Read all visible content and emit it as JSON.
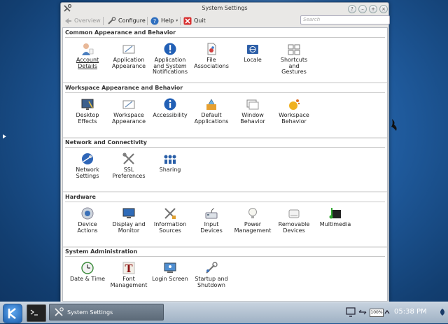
{
  "window": {
    "title": "System Settings",
    "search_placeholder": "Search"
  },
  "toolbar": {
    "overview": "Overview",
    "configure": "Configure",
    "help": "Help",
    "quit": "Quit"
  },
  "sections": [
    {
      "title": "Common Appearance and Behavior",
      "items": [
        {
          "label": "Account\nDetails",
          "icon": "account-icon"
        },
        {
          "label": "Application\nAppearance",
          "icon": "appearance-icon"
        },
        {
          "label": "Application\nand System\nNotifications",
          "icon": "notifications-icon"
        },
        {
          "label": "File\nAssociations",
          "icon": "file-associations-icon"
        },
        {
          "label": "Locale",
          "icon": "locale-icon"
        },
        {
          "label": "Shortcuts\nand\nGestures",
          "icon": "shortcuts-icon"
        }
      ]
    },
    {
      "title": "Workspace Appearance and Behavior",
      "items": [
        {
          "label": "Desktop\nEffects",
          "icon": "desktop-effects-icon"
        },
        {
          "label": "Workspace\nAppearance",
          "icon": "workspace-appearance-icon"
        },
        {
          "label": "Accessibility",
          "icon": "accessibility-icon"
        },
        {
          "label": "Default\nApplications",
          "icon": "default-applications-icon"
        },
        {
          "label": "Window\nBehavior",
          "icon": "window-behavior-icon"
        },
        {
          "label": "Workspace\nBehavior",
          "icon": "workspace-behavior-icon"
        }
      ]
    },
    {
      "title": "Network and Connectivity",
      "items": [
        {
          "label": "Network\nSettings",
          "icon": "network-settings-icon"
        },
        {
          "label": "SSL\nPreferences",
          "icon": "ssl-preferences-icon"
        },
        {
          "label": "Sharing",
          "icon": "sharing-icon"
        }
      ]
    },
    {
      "title": "Hardware",
      "items": [
        {
          "label": "Device\nActions",
          "icon": "device-actions-icon"
        },
        {
          "label": "Display and\nMonitor",
          "icon": "display-icon"
        },
        {
          "label": "Information\nSources",
          "icon": "information-sources-icon"
        },
        {
          "label": "Input\nDevices",
          "icon": "input-devices-icon"
        },
        {
          "label": "Power\nManagement",
          "icon": "power-management-icon"
        },
        {
          "label": "Removable\nDevices",
          "icon": "removable-devices-icon"
        },
        {
          "label": "Multimedia",
          "icon": "multimedia-icon"
        }
      ]
    },
    {
      "title": "System Administration",
      "items": [
        {
          "label": "Date & Time",
          "icon": "date-time-icon"
        },
        {
          "label": "Font\nManagement",
          "icon": "font-management-icon"
        },
        {
          "label": "Login Screen",
          "icon": "login-screen-icon"
        },
        {
          "label": "Startup and\nShutdown",
          "icon": "startup-shutdown-icon"
        }
      ]
    }
  ],
  "taskbar": {
    "task_label": "System Settings",
    "battery": "100%",
    "clock": "05:38 PM"
  }
}
